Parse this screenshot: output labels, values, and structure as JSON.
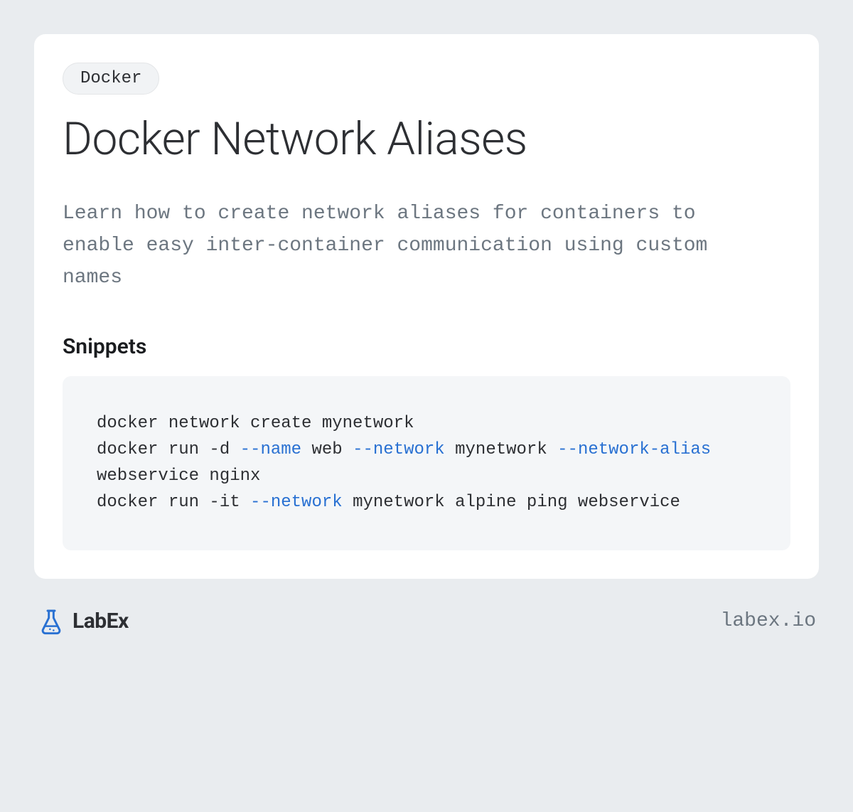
{
  "badge": "Docker",
  "title": "Docker Network Aliases",
  "description": "Learn how to create network aliases for containers to enable easy inter-container communication using custom names",
  "snippets_heading": "Snippets",
  "code": {
    "tokens": [
      {
        "t": "docker network create mynetwork\n",
        "flag": false
      },
      {
        "t": "docker run -d ",
        "flag": false
      },
      {
        "t": "--name",
        "flag": true
      },
      {
        "t": " web ",
        "flag": false
      },
      {
        "t": "--network",
        "flag": true
      },
      {
        "t": " mynetwork ",
        "flag": false
      },
      {
        "t": "--network-alias",
        "flag": true
      },
      {
        "t": " webservice nginx\n",
        "flag": false
      },
      {
        "t": "docker run -it ",
        "flag": false
      },
      {
        "t": "--network",
        "flag": true
      },
      {
        "t": " mynetwork alpine ping webservice",
        "flag": false
      }
    ]
  },
  "footer": {
    "brand": "LabEx",
    "url": "labex.io"
  }
}
